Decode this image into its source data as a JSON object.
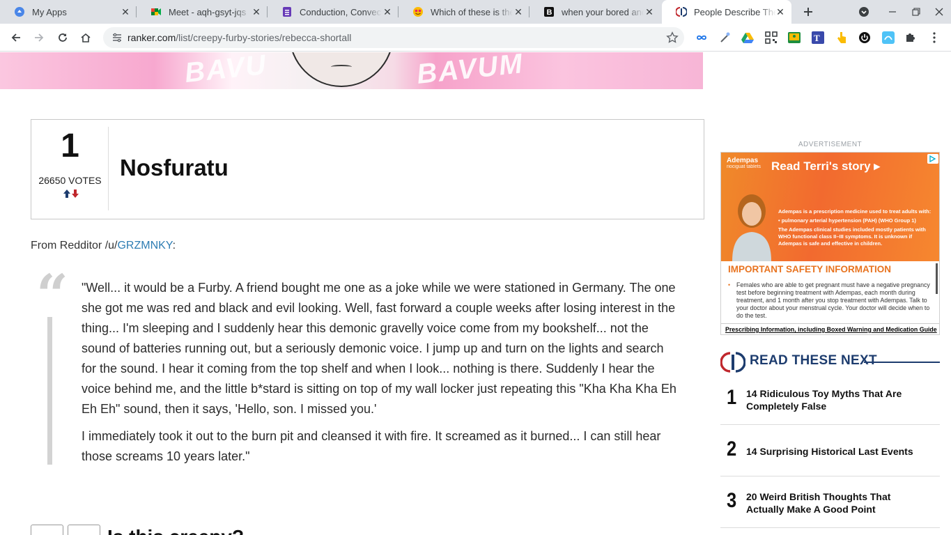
{
  "browser": {
    "tabs": [
      {
        "title": "My Apps",
        "icon": "google-apps-icon"
      },
      {
        "title": "Meet - aqh-gsyt-jqs",
        "icon": "google-meet-icon"
      },
      {
        "title": "Conduction, Convection",
        "icon": "google-forms-icon"
      },
      {
        "title": "Which of these is the",
        "icon": "emoji-icon"
      },
      {
        "title": "when your bored and",
        "icon": "b-logo-icon"
      },
      {
        "title": "People Describe The",
        "icon": "ranker-icon",
        "active": true
      }
    ],
    "address": {
      "domain": "ranker.com",
      "path": "/list/creepy-furby-stories/rebecca-shortall"
    }
  },
  "entry": {
    "rank": "1",
    "votes": "26650",
    "votes_label": "VOTES",
    "title": "Nosfuratu",
    "source_prefix": "From Redditor /u/",
    "source_user": "GRZMNKY",
    "source_suffix": ":",
    "quote_paragraphs": [
      "\"Well... it would be a Furby. A friend bought me one as a joke while we were stationed in Germany. The one she got me was red and black and evil looking. Well, fast forward a couple weeks after losing interest in the thing... I'm sleeping and I suddenly hear this demonic gravelly voice come from my bookshelf... not the sound of batteries running out, but a seriously demonic voice. I jump up and turn on the lights and search for the sound. I hear it coming from the top shelf and when I look... nothing is there. Suddenly I hear the voice behind me, and the little b*stard is sitting on top of my wall locker just repeating this \"Kha Kha Kha Eh Eh Eh\" sound, then it says, 'Hello, son. I missed you.'",
      "I immediately took it out to the burn pit and cleansed it with fire. It screamed as it burned... I can still hear those screams 10 years later.\""
    ],
    "next_question": "Is this creepy?"
  },
  "sidebar": {
    "ad_label": "ADVERTISEMENT",
    "ad": {
      "brand": "Adempas",
      "brand_sub": "riociguat tablets",
      "cta": "Read Terri's story",
      "copy": [
        "Adempas is a prescription medicine used to treat adults with:",
        "• pulmonary arterial hypertension (PAH) (WHO Group 1)",
        "The Adempas clinical studies included mostly patients with WHO functional class II–III symptoms. It is unknown if Adempas is safe and effective in children."
      ],
      "isi_title": "IMPORTANT SAFETY INFORMATION",
      "isi_text": "Females who are able to get pregnant must have a negative pregnancy test before beginning treatment with Adempas, each month during treatment, and 1 month after you stop treatment with Adempas. Talk to your doctor about your menstrual cycle. Your doctor will decide when to do the test.",
      "pi_link": "Prescribing Information, including Boxed Warning and Medication Guide"
    },
    "read_next_title": "READ THESE NEXT",
    "read_next": [
      {
        "n": "1",
        "title": "14 Ridiculous Toy Myths That Are Completely False"
      },
      {
        "n": "2",
        "title": "14 Surprising Historical Last Events"
      },
      {
        "n": "3",
        "title": "20 Weird British Thoughts That Actually Make A Good Point"
      }
    ]
  }
}
